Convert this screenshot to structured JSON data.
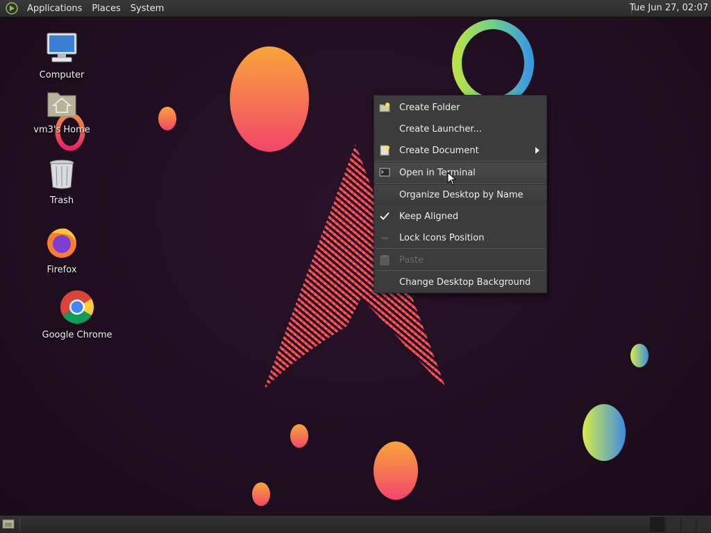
{
  "top_panel": {
    "menus": [
      "Applications",
      "Places",
      "System"
    ],
    "clock": "Tue Jun 27, 02:07"
  },
  "desktop_icons": [
    {
      "label": "Computer",
      "icon": "computer-icon"
    },
    {
      "label": "vm3's Home",
      "icon": "home-folder-icon"
    },
    {
      "label": "Trash",
      "icon": "trash-icon"
    },
    {
      "label": "Firefox",
      "icon": "firefox-icon"
    },
    {
      "label": "Google Chrome",
      "icon": "chrome-icon"
    }
  ],
  "context_menu": {
    "items": [
      {
        "label": "Create Folder",
        "icon": "folder-new-icon"
      },
      {
        "label": "Create Launcher...",
        "icon": ""
      },
      {
        "label": "Create Document",
        "icon": "document-new-icon",
        "submenu": true
      },
      {
        "label": "Open in Terminal",
        "icon": "terminal-icon"
      },
      {
        "label": "Organize Desktop by Name",
        "icon": ""
      },
      {
        "label": "Keep Aligned",
        "icon": "check-icon",
        "checked": true
      },
      {
        "label": "Lock Icons Position",
        "icon": "lock-icon"
      },
      {
        "label": "Paste",
        "icon": "paste-icon",
        "disabled": true
      },
      {
        "label": "Change Desktop Background",
        "icon": ""
      }
    ]
  },
  "colors": {
    "panel": "#2b2b2b",
    "menu_bg": "#3c3c3c",
    "desktop_bg": "#1f0e1f",
    "accent_pink": "#e8306e",
    "accent_orange": "#f59a3c"
  }
}
